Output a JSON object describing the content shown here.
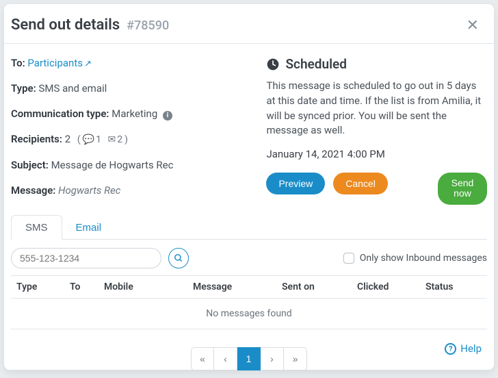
{
  "header": {
    "title": "Send out details",
    "id": "#78590"
  },
  "details": {
    "to_label": "To",
    "to_value": "Participants",
    "type_label": "Type",
    "type_value": "SMS and email",
    "comm_type_label": "Communication type",
    "comm_type_value": "Marketing",
    "recipients_label": "Recipients",
    "recipients_count": "2",
    "recipients_sms": "1",
    "recipients_email": "2",
    "subject_label": "Subject",
    "subject_value": "Message de Hogwarts Rec",
    "message_label": "Message",
    "message_value": "Hogwarts Rec"
  },
  "status": {
    "heading": "Scheduled",
    "description": "This message is scheduled to go out in 5 days at this date and time. If the list is from Amilia, it will be synced prior. You will be sent the message as well.",
    "datetime": "January 14, 2021 4:00 PM"
  },
  "buttons": {
    "preview": "Preview",
    "cancel": "Cancel",
    "send_now": "Send now"
  },
  "tabs": {
    "sms": "SMS",
    "email": "Email"
  },
  "filter": {
    "phone_placeholder": "555-123-1234",
    "inbound_label": "Only show Inbound messages"
  },
  "table": {
    "headers": [
      "Type",
      "To",
      "Mobile",
      "Message",
      "Sent on",
      "Clicked",
      "Status"
    ],
    "empty": "No messages found"
  },
  "pager": {
    "first": "«",
    "prev": "‹",
    "page": "1",
    "next": "›",
    "last": "»"
  },
  "help_label": "Help"
}
